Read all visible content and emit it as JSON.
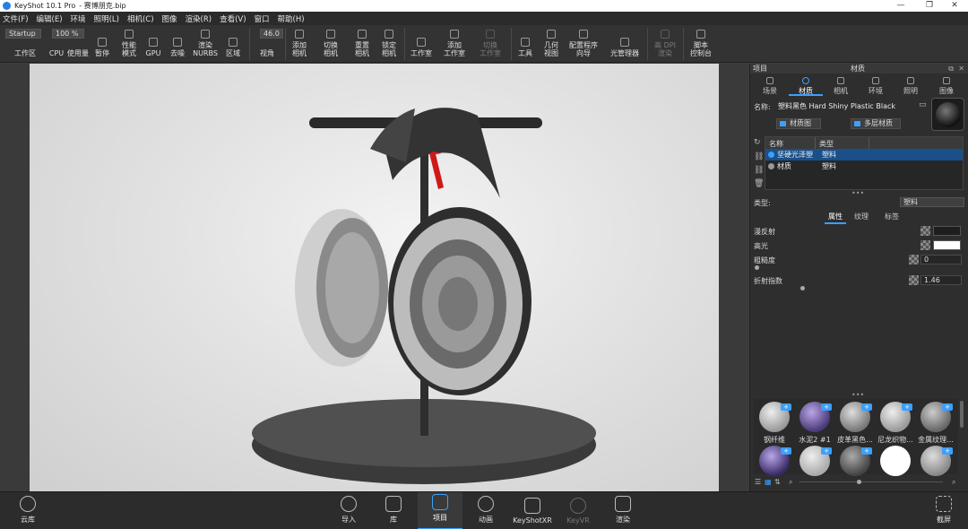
{
  "window": {
    "app_title": "KeyShot 10.1 Pro",
    "file_name": "- 赛博朋克.bip",
    "controls": [
      "—",
      "❐",
      "✕"
    ]
  },
  "menu": [
    "文件(F)",
    "编辑(E)",
    "环境",
    "照明(L)",
    "相机(C)",
    "图像",
    "渲染(R)",
    "查看(V)",
    "窗口",
    "帮助(H)"
  ],
  "toolbar": {
    "workspace_value": "Startup",
    "zoom_value": "100 %",
    "fov_value": "46.0",
    "items": {
      "workspace": "工作区",
      "cpu": "CPU",
      "usage": "使用量",
      "pause": "暂停",
      "perf_mode": "性能\n模式",
      "gpu": "GPU",
      "denoise": "去噪",
      "render_nurbs": "渲染\nNURBS",
      "region": "区域",
      "view_angle": "视角",
      "add_camera": "添加\n相机",
      "switch_camera": "切换\n相机",
      "reset_camera": "重置\n相机",
      "lock_camera": "锁定\n相机",
      "studio": "工作室",
      "add_studio": "添加\n工作室",
      "switch_studio": "切换\n工作室",
      "tools": "工具",
      "geometry_view": "几何\n视图",
      "config_wizard": "配置程序\n向导",
      "light_manager": "光管理器",
      "hdpi_render": "高 DPI\n渲染",
      "script_console": "脚本\n控制台"
    }
  },
  "panel": {
    "header_left": "项目",
    "header_title": "材质",
    "tabs": [
      "场景",
      "材质",
      "相机",
      "环境",
      "照明",
      "图像"
    ],
    "active_tab": "材质",
    "name_label": "名称:",
    "name_value": "塑料黑色 Hard Shiny Plastic Black",
    "material_graph_btn": "材质图",
    "multi_material_btn": "多层材质",
    "table": {
      "columns": [
        "名称",
        "类型"
      ],
      "rows": [
        {
          "name": "坚硬光泽塑",
          "type": "塑料",
          "selected": true
        },
        {
          "name": "材质",
          "type": "塑料",
          "selected": false
        }
      ]
    },
    "type_label": "类型:",
    "type_value": "塑料",
    "subtabs": [
      "属性",
      "纹理",
      "标签"
    ],
    "active_subtab": "属性",
    "props": {
      "diffuse": "漫反射",
      "diffuse_color": "#1e1e1e",
      "specular": "高光",
      "specular_color": "#ffffff",
      "roughness": "粗糙度",
      "roughness_value": "0",
      "ior": "折射指数",
      "ior_value": "1.46"
    },
    "library": [
      {
        "label": "钢纤维",
        "color": "#c8c8c8"
      },
      {
        "label": "水泥2 #1",
        "color": "#6a5a8a"
      },
      {
        "label": "皮革黑色...",
        "color": "#9a9a9a"
      },
      {
        "label": "尼龙织物...",
        "color": "#b0b0b0"
      },
      {
        "label": "金属纹理...",
        "color": "#8a8a8a"
      },
      {
        "label": "",
        "color": "#5c4a88"
      },
      {
        "label": "",
        "color": "#c0c0c0"
      },
      {
        "label": "",
        "color": "#7a7a7a"
      },
      {
        "label": "",
        "color": "#ffffff"
      },
      {
        "label": "",
        "color": "#9a9a9a"
      }
    ]
  },
  "bottombar": {
    "cloud": "云库",
    "import": "导入",
    "library": "库",
    "project": "项目",
    "animation": "动画",
    "keyshotxr": "KeyShotXR",
    "render_dim": "KeyVR",
    "render": "渲染",
    "screenshot": "截屏"
  }
}
